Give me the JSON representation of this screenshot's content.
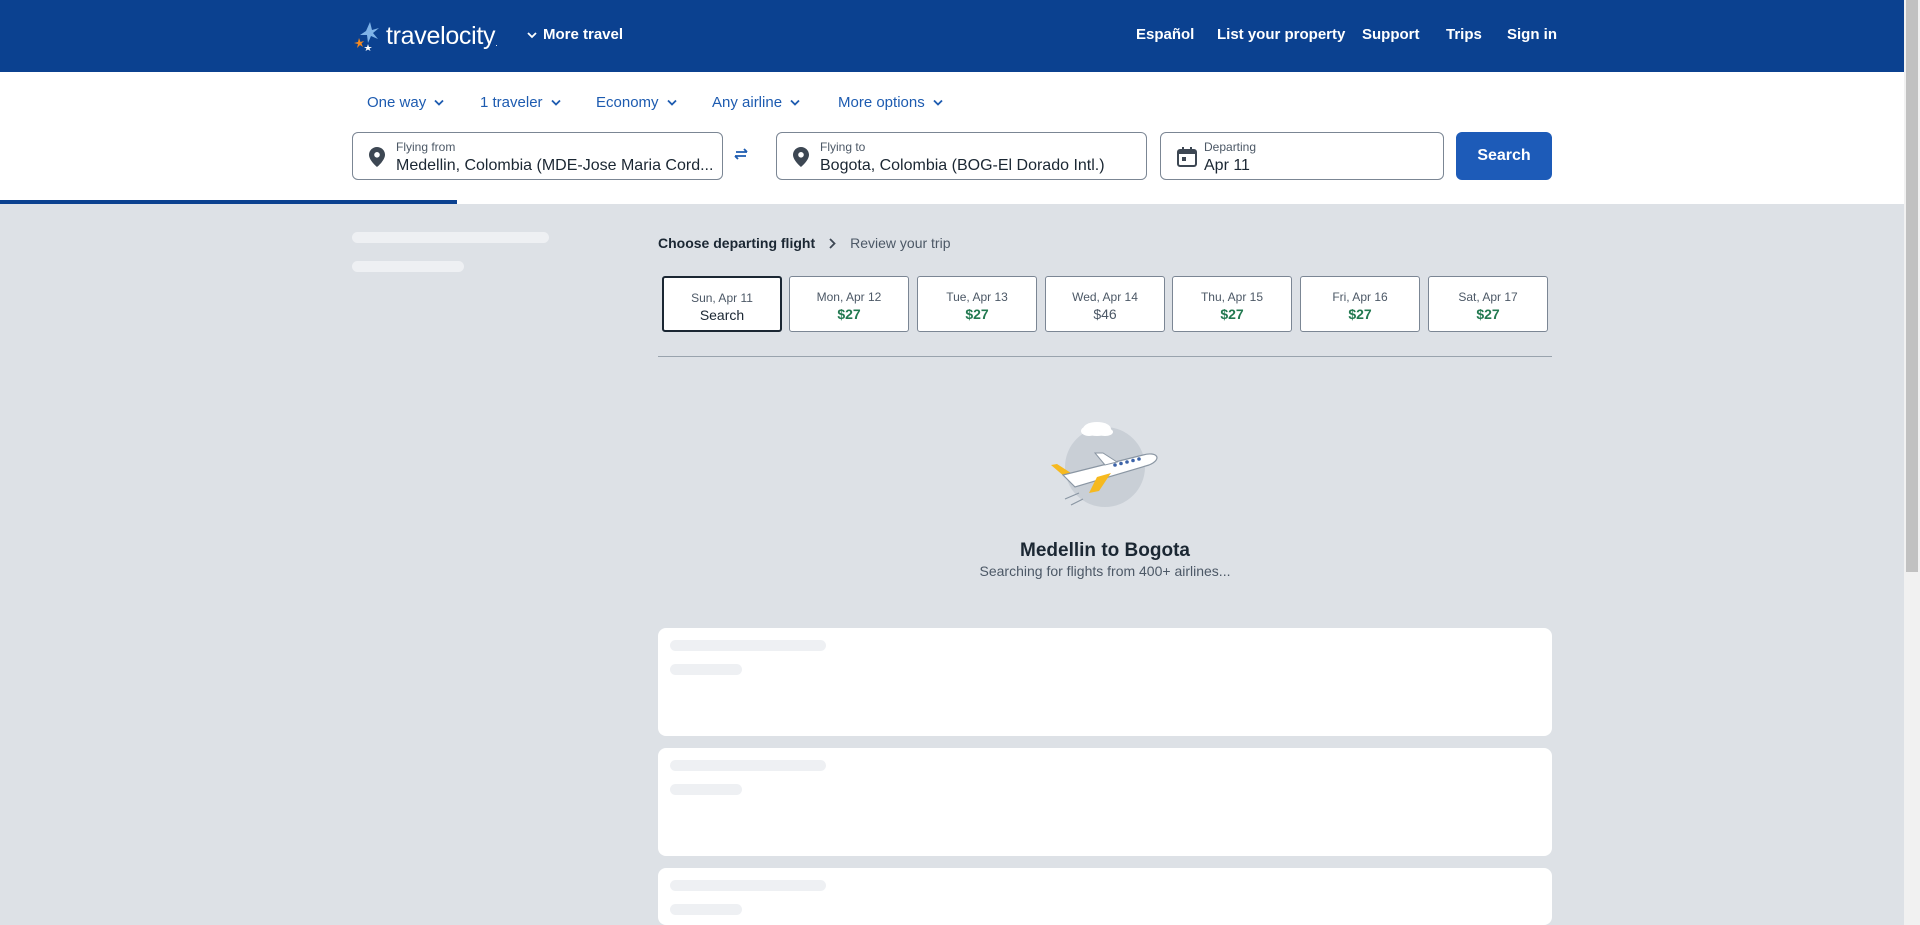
{
  "header": {
    "logo_text": "travelocity",
    "logo_mark": ".",
    "more_travel": "More travel",
    "nav": {
      "espanol": "Español",
      "list_property": "List your property",
      "support": "Support",
      "trips": "Trips",
      "sign_in": "Sign in"
    }
  },
  "filters": {
    "trip_type": "One way",
    "travelers": "1 traveler",
    "cabin": "Economy",
    "airline": "Any airline",
    "more_options": "More options"
  },
  "search": {
    "from_label": "Flying from",
    "from_value": "Medellin, Colombia (MDE-Jose Maria Cord...",
    "to_label": "Flying to",
    "to_value": "Bogota, Colombia (BOG-El Dorado Intl.)",
    "depart_label": "Departing",
    "depart_value": "Apr 11",
    "button": "Search",
    "progress_fraction": 0.24
  },
  "breadcrumb": {
    "current": "Choose departing flight",
    "next": "Review your trip"
  },
  "date_tabs": [
    {
      "date": "Sun, Apr 11",
      "price": "Search",
      "style": "dark",
      "active": true
    },
    {
      "date": "Mon, Apr 12",
      "price": "$27",
      "style": "green",
      "active": false
    },
    {
      "date": "Tue, Apr 13",
      "price": "$27",
      "style": "green",
      "active": false
    },
    {
      "date": "Wed, Apr 14",
      "price": "$46",
      "style": "plain",
      "active": false
    },
    {
      "date": "Thu, Apr 15",
      "price": "$27",
      "style": "green",
      "active": false
    },
    {
      "date": "Fri, Apr 16",
      "price": "$27",
      "style": "green",
      "active": false
    },
    {
      "date": "Sat, Apr 17",
      "price": "$27",
      "style": "green",
      "active": false
    }
  ],
  "loading": {
    "title": "Medellin to Bogota",
    "subtitle": "Searching for flights from 400+ airlines..."
  },
  "colors": {
    "brand_blue": "#0b4190",
    "button_blue": "#1d5bb8",
    "price_green": "#227950",
    "page_bg": "#dde1e6"
  }
}
